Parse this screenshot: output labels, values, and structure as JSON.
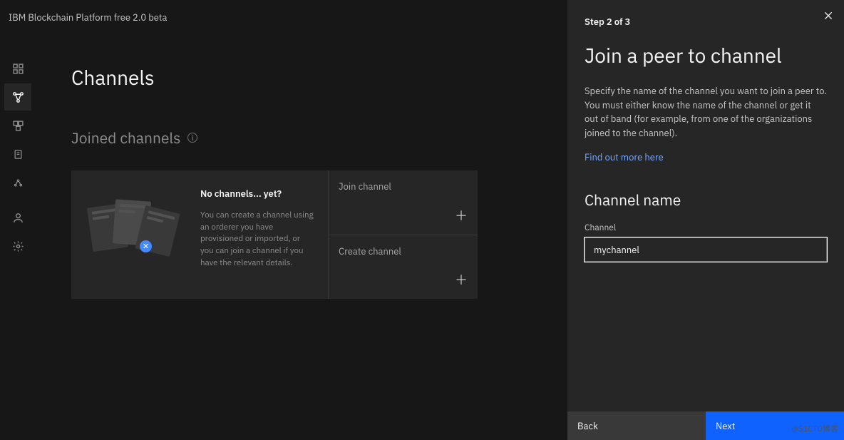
{
  "header": {
    "title": "IBM Blockchain Platform free 2.0 beta"
  },
  "sidebar": {
    "items": [
      {
        "name": "dashboard-icon"
      },
      {
        "name": "nodes-icon",
        "active": true
      },
      {
        "name": "channels-icon"
      },
      {
        "name": "smart-contracts-icon"
      },
      {
        "name": "wallet-icon"
      },
      {
        "name": "user-icon"
      },
      {
        "name": "settings-icon"
      }
    ]
  },
  "main": {
    "title": "Channels",
    "section_title": "Joined channels",
    "empty_state": {
      "title": "No channels... yet?",
      "desc": "You can create a channel using an orderer you have provisioned or imported, or you can join a channel if you have the relevant details."
    },
    "action_cards": [
      {
        "label": "Join channel"
      },
      {
        "label": "Create channel"
      }
    ]
  },
  "panel": {
    "step": "Step 2 of 3",
    "title": "Join a peer to channel",
    "desc": "Specify the name of the channel you want to join a peer to. You must either know the name of the channel or get it out of band (for example, from one of the organizations joined to the channel).",
    "link": "Find out more here",
    "subtitle": "Channel name",
    "field_label": "Channel",
    "field_value": "mychannel",
    "back": "Back",
    "next": "Next"
  },
  "watermark": "@51CTO博客"
}
